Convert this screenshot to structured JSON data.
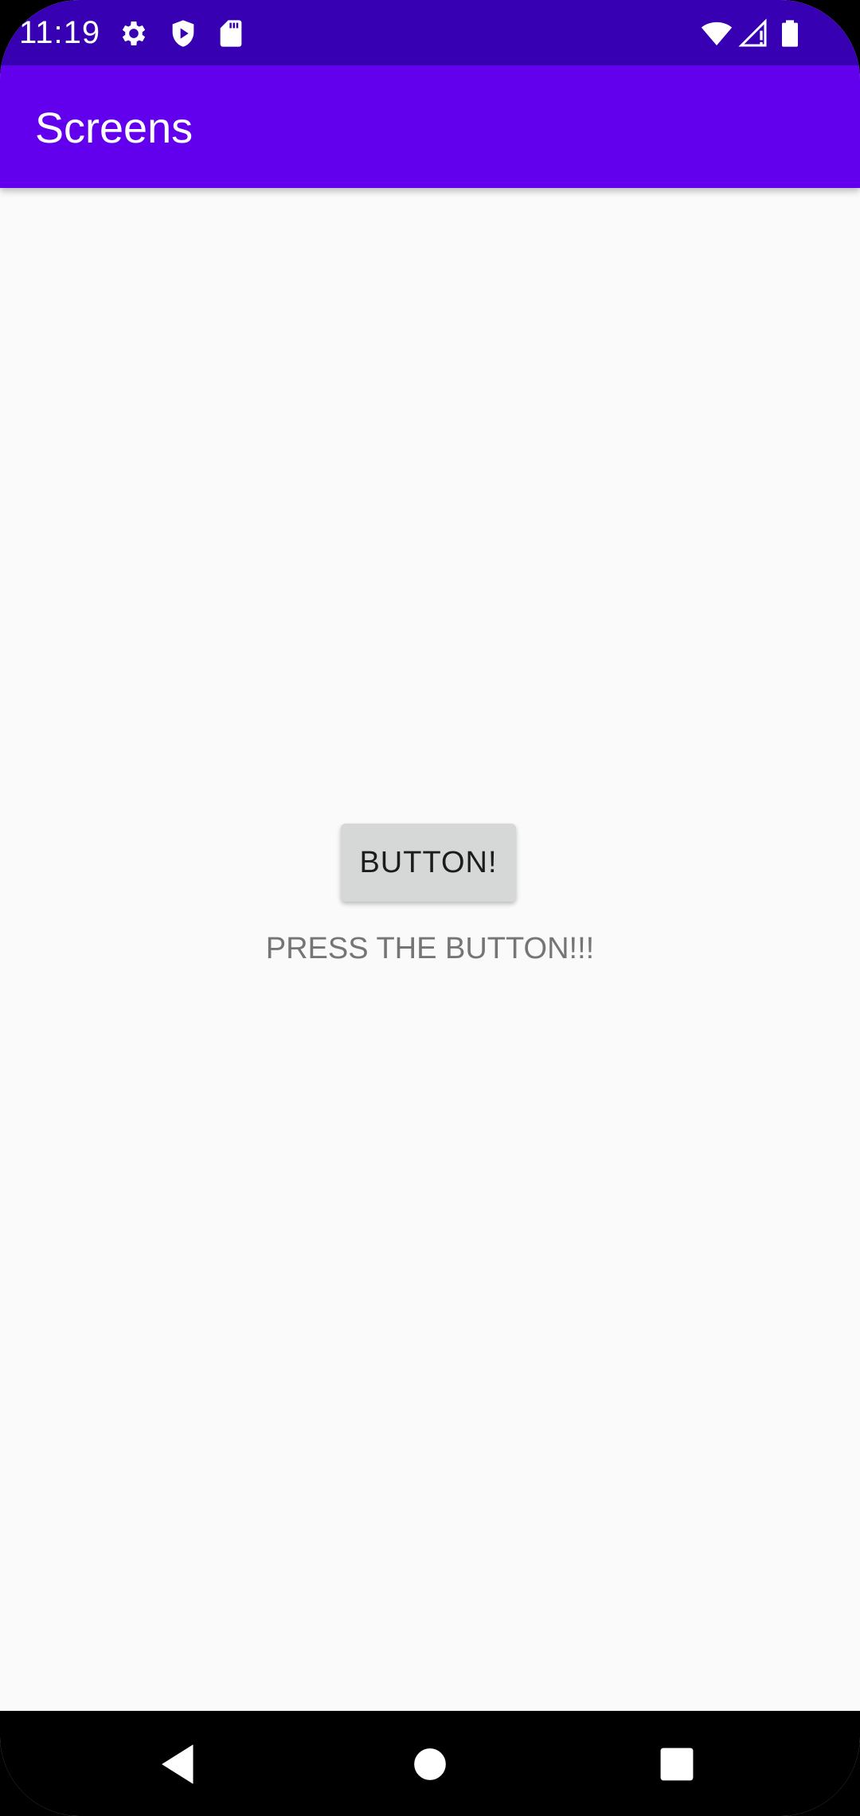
{
  "status_bar": {
    "time": "11:19",
    "background": "#3700B3",
    "left_icons": [
      "gear-icon",
      "shield-play-icon",
      "sd-card-icon"
    ],
    "right_icons": [
      "wifi-icon",
      "cell-signal-icon",
      "battery-icon"
    ]
  },
  "app_bar": {
    "title": "Screens",
    "background": "#6200EE"
  },
  "main": {
    "button_label": "BUTTON!",
    "hint_text": "PRESS THE BUTTON!!!"
  },
  "nav_bar": {
    "items": [
      "back-icon",
      "home-icon",
      "recents-icon"
    ]
  }
}
